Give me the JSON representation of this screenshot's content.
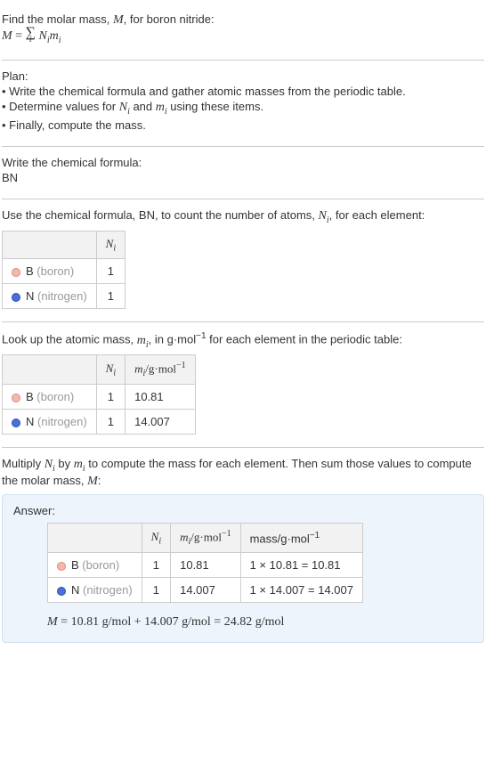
{
  "intro": {
    "line1": "Find the molar mass, M, for boron nitride:",
    "formula_M": "M",
    "formula_eq": " = ",
    "formula_sum_i": "i",
    "formula_Ni": "N",
    "formula_mi": "m"
  },
  "plan": {
    "heading": "Plan:",
    "item1": "• Write the chemical formula and gather atomic masses from the periodic table.",
    "item2_pre": "• Determine values for ",
    "item2_mid": " and ",
    "item2_post": " using these items.",
    "item3": "• Finally, compute the mass."
  },
  "chemformula": {
    "heading": "Write the chemical formula:",
    "value": "BN"
  },
  "count": {
    "heading_pre": "Use the chemical formula, BN, to count the number of atoms, ",
    "heading_post": ", for each element:",
    "col_ni": "N",
    "rows": [
      {
        "dot": "b",
        "sym": "B",
        "name": "(boron)",
        "ni": "1"
      },
      {
        "dot": "n",
        "sym": "N",
        "name": "(nitrogen)",
        "ni": "1"
      }
    ]
  },
  "lookup": {
    "heading_pre": "Look up the atomic mass, ",
    "heading_mid": ", in g·mol",
    "heading_post": " for each element in the periodic table:",
    "col_ni": "N",
    "col_mi": "m",
    "col_mi_unit": "/g·mol",
    "rows": [
      {
        "dot": "b",
        "sym": "B",
        "name": "(boron)",
        "ni": "1",
        "mi": "10.81"
      },
      {
        "dot": "n",
        "sym": "N",
        "name": "(nitrogen)",
        "ni": "1",
        "mi": "14.007"
      }
    ]
  },
  "multiply": {
    "line_pre": "Multiply ",
    "line_mid": " by ",
    "line_post": " to compute the mass for each element. Then sum those values to compute the molar mass, ",
    "line_end": ":"
  },
  "answer": {
    "label": "Answer:",
    "col_ni": "N",
    "col_mi": "m",
    "col_mi_unit": "/g·mol",
    "col_mass": "mass/g·mol",
    "rows": [
      {
        "dot": "b",
        "sym": "B",
        "name": "(boron)",
        "ni": "1",
        "mi": "10.81",
        "mass": "1 × 10.81 = 10.81"
      },
      {
        "dot": "n",
        "sym": "N",
        "name": "(nitrogen)",
        "ni": "1",
        "mi": "14.007",
        "mass": "1 × 14.007 = 14.007"
      }
    ],
    "result": "M = 10.81 g/mol + 14.007 g/mol = 24.82 g/mol"
  }
}
